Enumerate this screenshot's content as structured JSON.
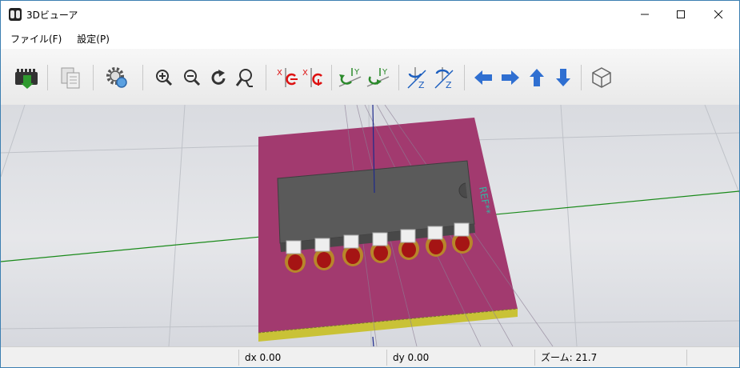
{
  "window": {
    "title": "3Dビューア"
  },
  "menu": {
    "items": [
      "ファイル(F)",
      "設定(P)"
    ]
  },
  "toolbar": {
    "buttons": [
      "reload-board-icon",
      "copy-image-icon",
      "render-settings-icon",
      "zoom-in-icon",
      "zoom-out-icon",
      "redraw-icon",
      "zoom-fit-icon",
      "rotate-x-cw-icon",
      "rotate-x-ccw-icon",
      "rotate-y-cw-icon",
      "rotate-y-ccw-icon",
      "rotate-z-cw-icon",
      "rotate-z-ccw-icon",
      "pan-left-icon",
      "pan-right-icon",
      "pan-up-icon",
      "pan-down-icon",
      "orthographic-view-icon"
    ]
  },
  "viewport": {
    "silkscreen_text": "REF**"
  },
  "status": {
    "dx": "dx 0.00",
    "dy": "dy 0.00",
    "zoom": "ズーム: 21.7"
  },
  "colors": {
    "pcb": "#a23a6f",
    "pcb_edge": "#c9c236",
    "ic_body": "#5a5a5a",
    "pad": "#b8862a",
    "x_axis": "#1a8a1a",
    "y_axis": "#1e2a8c"
  }
}
